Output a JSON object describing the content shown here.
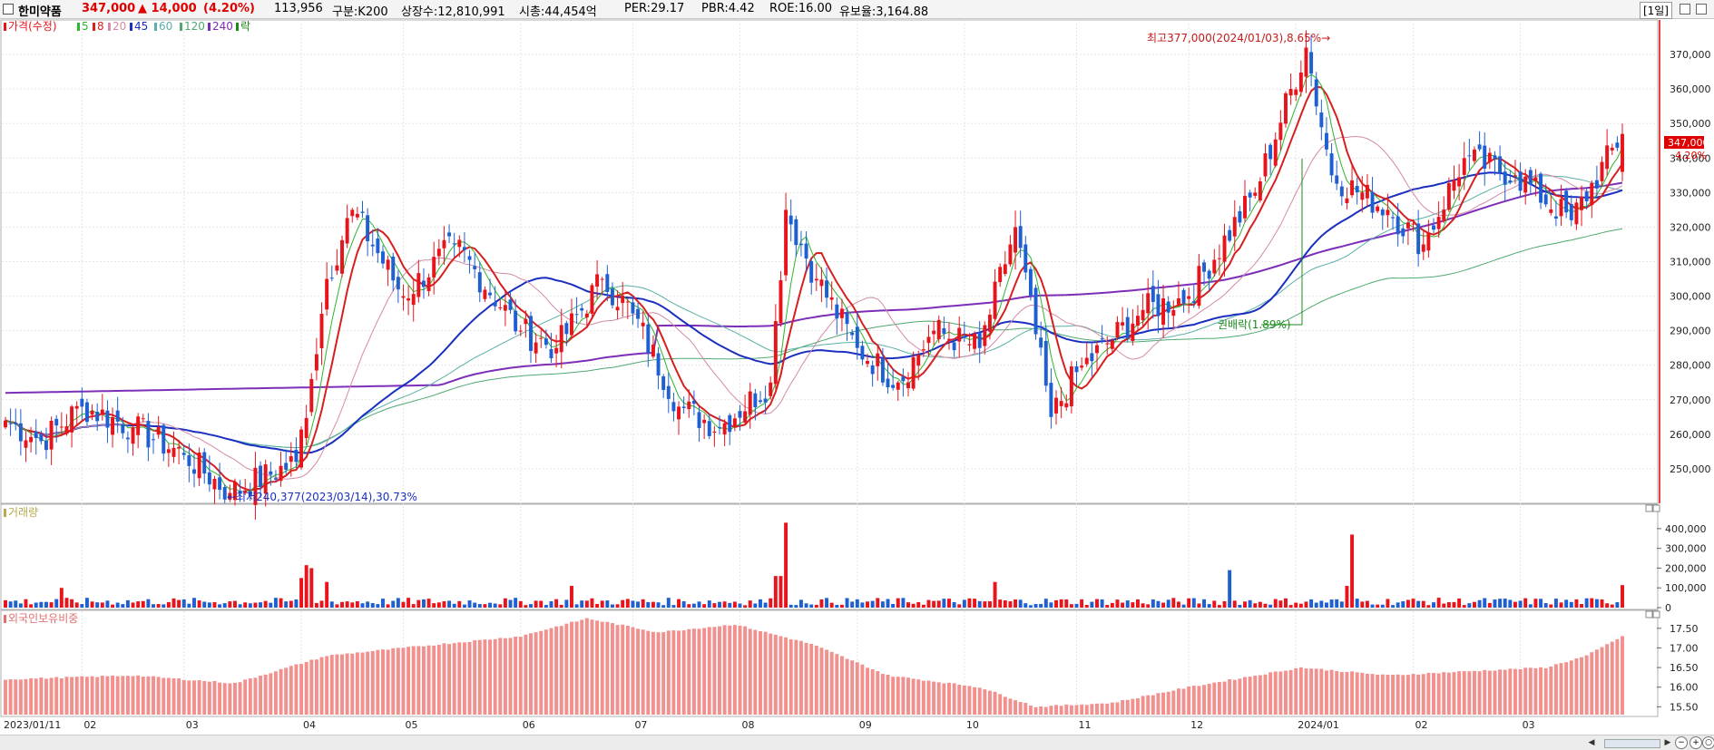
{
  "header": {
    "stock_name": "한미약품",
    "price": "347,000",
    "change": "▲ 14,000",
    "change_pct": "(4.20%)",
    "volume": "113,956",
    "market": "구분:K200",
    "shares": "상장수:12,810,991",
    "market_cap": "시총:44,454억",
    "per": "PER:29.17",
    "pbr": "PBR:4.42",
    "roe": "ROE:16.00",
    "retention": "유보율:3,164.88",
    "period": "[1일]"
  },
  "colors": {
    "up": "#e8141c",
    "down": "#1e5fd1",
    "ma5": "#2db52d",
    "ma8": "#d61f1f",
    "ma20": "#d48aa8",
    "ma45": "#1a2fc0",
    "ma60": "#5ab0a8",
    "ma120": "#4fa870",
    "ma240": "#7d2eb8",
    "foreign": "#f2908e"
  },
  "price_panel": {
    "legend": {
      "price": "가격(수정)",
      "ma5": "5",
      "ma8": "8",
      "ma20": "20",
      "ma45": "45",
      "ma60": "60",
      "ma120": "120",
      "ma240": "240",
      "ex": "락"
    },
    "high_annotation": "최고377,000(2024/01/03),8.65%→",
    "low_annotation": "←최저240,377(2023/03/14),30.73%",
    "dividend_annotation": "권배락(1.89%)",
    "last_price_label": "347,000",
    "last_pct_label": "4.20%"
  },
  "volume_panel": {
    "legend": "거래량"
  },
  "foreign_panel": {
    "legend": "외국인보유비중"
  },
  "chart_data": [
    {
      "type": "candlestick",
      "title": "가격(수정)",
      "x_ticks": [
        "2023/01/11",
        "02",
        "03",
        "04",
        "05",
        "06",
        "07",
        "08",
        "09",
        "10",
        "11",
        "12",
        "2024/01",
        "02",
        "03"
      ],
      "ylim": [
        240000,
        380000
      ],
      "y_ticks": [
        250000,
        260000,
        270000,
        280000,
        290000,
        300000,
        310000,
        320000,
        330000,
        340000,
        350000,
        360000,
        370000
      ],
      "anchors": {
        "dates": [
          "2023/01/11",
          "2023/01/20",
          "2023/02/01",
          "2023/02/15",
          "2023/03/01",
          "2023/03/14",
          "2023/03/31",
          "2023/04/05",
          "2023/04/10",
          "2023/04/17",
          "2023/05/01",
          "2023/05/15",
          "2023/06/01",
          "2023/06/12",
          "2023/06/23",
          "2023/07/03",
          "2023/07/14",
          "2023/07/26",
          "2023/08/09",
          "2023/08/14",
          "2023/08/22",
          "2023/09/01",
          "2023/09/13",
          "2023/09/22",
          "2023/10/05",
          "2023/10/16",
          "2023/10/25",
          "2023/11/01",
          "2023/11/20",
          "2023/12/01",
          "2023/12/20",
          "2024/01/03",
          "2024/01/10",
          "2024/01/25",
          "2024/02/05",
          "2024/02/15",
          "2024/02/29",
          "2024/03/15",
          "2024/03/29"
        ],
        "close": [
          264000,
          258000,
          268000,
          262000,
          254000,
          243000,
          252000,
          276000,
          305000,
          325000,
          300000,
          315000,
          290000,
          285000,
          305000,
          295000,
          268000,
          262000,
          275000,
          325000,
          305000,
          285000,
          275000,
          290000,
          285000,
          320000,
          265000,
          278000,
          296000,
          300000,
          330000,
          372000,
          335000,
          325000,
          315000,
          340000,
          335000,
          322000,
          347000
        ]
      }
    },
    {
      "type": "bar",
      "title": "거래량",
      "ylim": [
        0,
        450000
      ],
      "y_ticks": [
        0,
        100000,
        200000,
        300000,
        400000
      ],
      "spikes": {
        "dates": [
          "2023/01/26",
          "2023/04/03",
          "2023/04/04",
          "2023/04/05",
          "2023/04/10",
          "2023/06/15",
          "2023/08/10",
          "2023/08/11",
          "2023/08/14",
          "2023/10/10",
          "2023/12/13",
          "2024/01/15",
          "2024/01/16",
          "2024/03/29"
        ],
        "values": [
          100000,
          150000,
          215000,
          200000,
          130000,
          110000,
          160000,
          160000,
          430000,
          130000,
          190000,
          110000,
          370000,
          113956
        ]
      }
    },
    {
      "type": "bar",
      "title": "외국인보유비중",
      "ylim": [
        15.3,
        17.75
      ],
      "y_ticks": [
        15.5,
        16.0,
        16.5,
        17.0,
        17.5
      ],
      "anchors": {
        "dates": [
          "2023/01/11",
          "2023/02/15",
          "2023/03/15",
          "2023/04/10",
          "2023/05/01",
          "2023/06/01",
          "2023/06/20",
          "2023/07/10",
          "2023/07/31",
          "2023/08/21",
          "2023/09/11",
          "2023/10/05",
          "2023/10/20",
          "2023/11/10",
          "2023/12/01",
          "2024/01/02",
          "2024/01/25",
          "2024/02/15",
          "2024/03/10",
          "2024/03/20",
          "2024/03/29"
        ],
        "values": [
          16.2,
          16.3,
          16.1,
          16.8,
          17.0,
          17.3,
          17.75,
          17.4,
          17.6,
          17.1,
          16.3,
          16.0,
          15.5,
          15.6,
          16.0,
          16.5,
          16.3,
          16.4,
          16.5,
          16.8,
          17.3
        ]
      }
    }
  ]
}
